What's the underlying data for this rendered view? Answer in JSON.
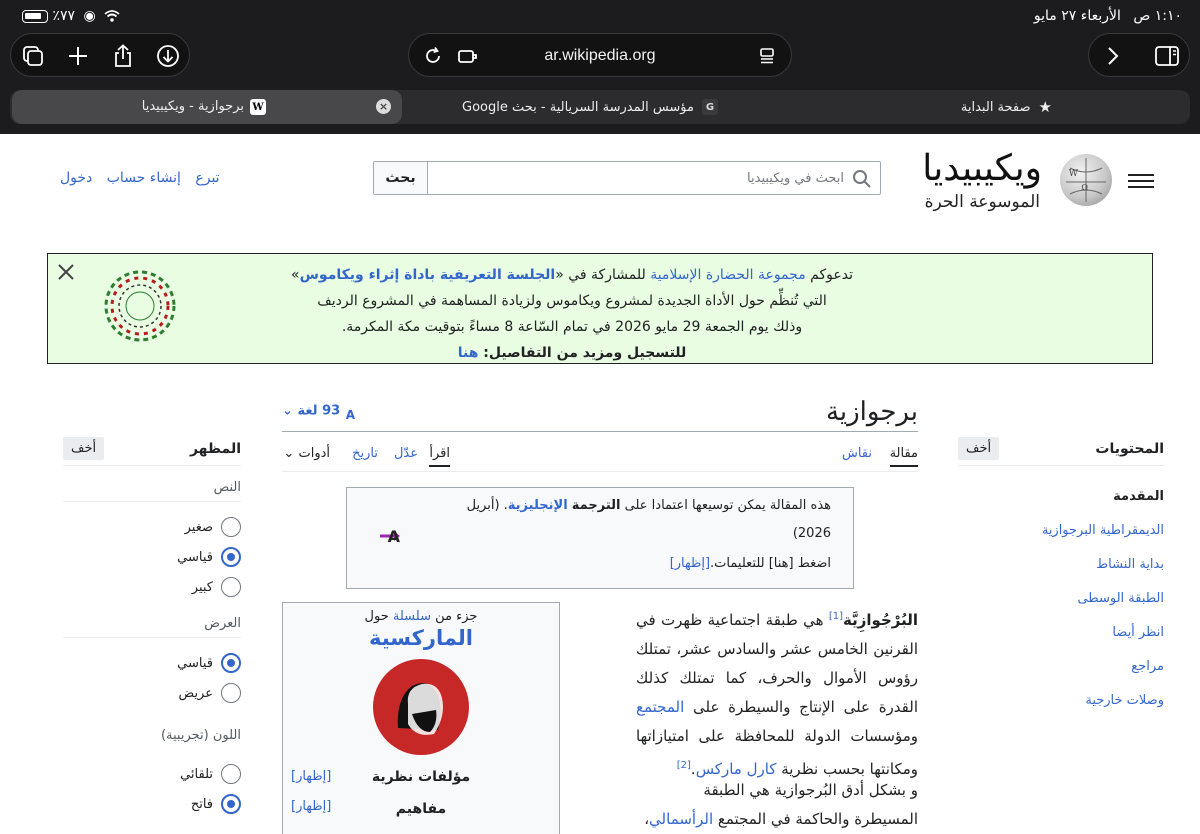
{
  "status": {
    "time": "١:١٠ ص",
    "date": "الأربعاء ٢٧ مايو",
    "battery": "٪٧٧"
  },
  "browser": {
    "url": "ar.wikipedia.org",
    "tabs": [
      {
        "label": "صفحة البداية",
        "icon": "star-icon",
        "active": false
      },
      {
        "label": "مؤسس المدرسة السريالية - بحث Google",
        "icon_letter": "G",
        "active": false
      },
      {
        "label": "برجوازية - ويكيبيديا",
        "icon_letter": "W",
        "active": true
      }
    ]
  },
  "header": {
    "wordmark": "ويكيبيديا",
    "tagline": "الموسوعة الحرة",
    "search_placeholder": "ابحث في ويكيبيديا",
    "search_button": "بحث",
    "user_links": [
      "تبرع",
      "إنشاء حساب",
      "دخول"
    ]
  },
  "banner": {
    "line1_a": "تدعوكم",
    "line1_link1": "مجموعة الحضارة الإسلامية",
    "line1_b": "للمشاركة في «",
    "line1_link2": "الجلسة التعريفية باداة إثراء ويكاموس",
    "line1_c": "»",
    "line2": "التي تُنظِّم حول الأداة الجديدة لمشروع ويكاموس ولزيادة المساهمة في المشروع الرديف",
    "line3": "وذلك يوم الجمعة 29 مايو 2026 في تمام السّاعة 8 مساءً بتوقيت مكة المكرمة.",
    "line4_a": "للتسجيل ومزيد من التفاصيل:",
    "line4_link": "هنا"
  },
  "toc": {
    "title": "المحتويات",
    "hide": "أخف",
    "items": [
      "المقدمة",
      "الديمقراطية البرجوازية",
      "بداية النشاط",
      "الطبقة الوسطى",
      "انظر أيضا",
      "مراجع",
      "وصلات خارجية"
    ]
  },
  "appearance": {
    "title": "المظهر",
    "hide": "أخف",
    "text_section": "النص",
    "text_options": [
      "صغير",
      "قياسي",
      "كبير"
    ],
    "text_selected": 1,
    "width_section": "العرض",
    "width_options": [
      "قياسي",
      "عريض"
    ],
    "width_selected": 0,
    "color_section": "اللون (تجريبية)",
    "color_options": [
      "تلقائي",
      "فاتح"
    ],
    "color_selected": 1
  },
  "article": {
    "title": "برجوازية",
    "languages": "93 لغة",
    "tabs": {
      "article": "مقالة",
      "talk": "نقاش",
      "read": "اقرأ",
      "edit": "عدّل",
      "history": "تاريخ",
      "tools": "أدوات"
    },
    "notice_line1_a": "هذه المقالة يمكن توسيعها اعتمادا على",
    "notice_line1_b": "الترجمة",
    "notice_line1_link": "الإنجليزية",
    "notice_line1_c": ". (أبريل",
    "notice_line2": "2026)",
    "notice_line3": "اضغط [هنا] للتعليمات.",
    "notice_show": "[إظهار]",
    "infobox": {
      "partof_a": "جزء من",
      "partof_link": "سلسلة",
      "partof_b": "حول",
      "title": "الماركسية",
      "row1": "مؤلفات نظرية",
      "row2": "مفاهيم",
      "show": "[إظهار]"
    },
    "para1_bold": "البُرْجُوازِيَّة",
    "para1_ref": "[1]",
    "para1_text": " هي طبقة اجتماعية ظهرت في القرنين الخامس عشر والسادس عشر، تمتلك رؤوس الأموال والحرف، كما تمتلك كذلك القدرة على الإنتاج والسيطرة على ",
    "para1_link1": "المجتمع",
    "para1_text2": " ومؤسسات الدولة للمحافظة على امتيازاتها ومكانتها بحسب نظرية ",
    "para1_link2": "كارل ماركس",
    "para1_end": ".",
    "para1_ref2": "[2]",
    "para2_text": "و بشكل أدق البُرجوازية هي الطبقة المسيطرة والحاكمة في المجتمع ",
    "para2_link": "الرأسمالي",
    "para2_end": "، وهي طبقة غير"
  }
}
